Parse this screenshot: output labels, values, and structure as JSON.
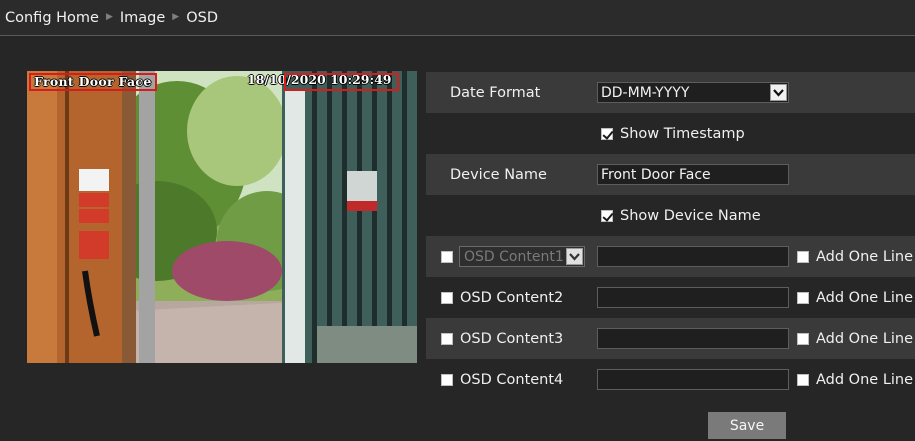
{
  "breadcrumb": {
    "items": [
      "Config Home",
      "Image",
      "OSD"
    ]
  },
  "preview": {
    "osd_name_text": "Front Door Face",
    "osd_time_text": "18/10/2020 10:29:49"
  },
  "form": {
    "date_format": {
      "label": "Date Format",
      "value": "DD-MM-YYYY"
    },
    "show_timestamp": {
      "label": "Show Timestamp",
      "checked": true
    },
    "device_name": {
      "label": "Device Name",
      "value": "Front Door Face"
    },
    "show_device_name": {
      "label": "Show Device Name",
      "checked": true
    },
    "osd_rows": [
      {
        "label": "OSD Content1",
        "checked": false,
        "value": "",
        "add_line_label": "Add One Line",
        "add_line_checked": false,
        "is_select": true
      },
      {
        "label": "OSD Content2",
        "checked": false,
        "value": "",
        "add_line_label": "Add One Line",
        "add_line_checked": false
      },
      {
        "label": "OSD Content3",
        "checked": false,
        "value": "",
        "add_line_label": "Add One Line",
        "add_line_checked": false
      },
      {
        "label": "OSD Content4",
        "checked": false,
        "value": "",
        "add_line_label": "Add One Line",
        "add_line_checked": false
      }
    ],
    "save_label": "Save"
  },
  "colors": {
    "background": "#262626",
    "row_shade": "#3a3a3a",
    "osd_box": "#d81c1c",
    "button": "#7a7a7a"
  }
}
